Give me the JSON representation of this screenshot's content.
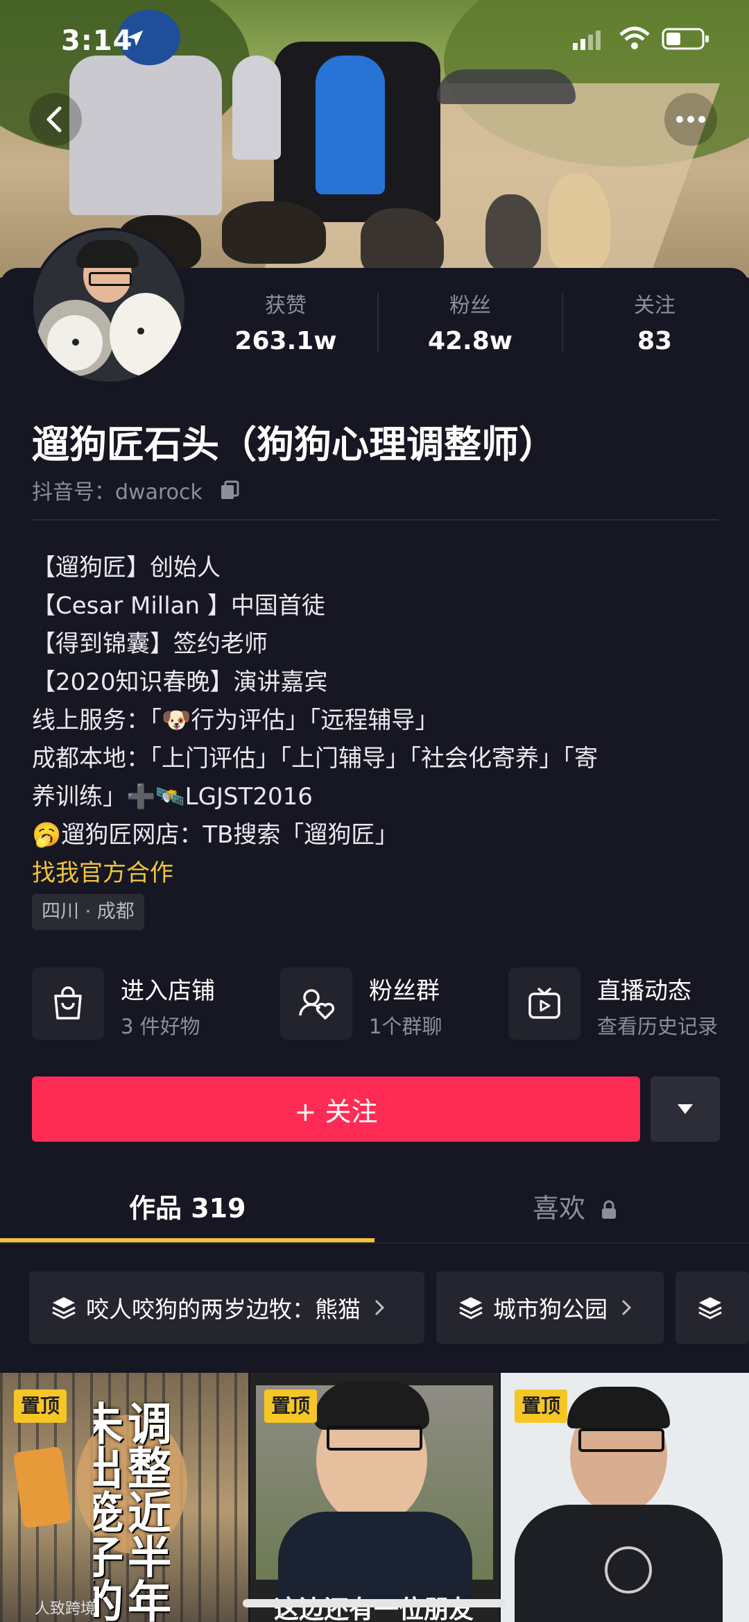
{
  "status_bar": {
    "time": "3:14"
  },
  "profile": {
    "stats": [
      {
        "label": "获赞",
        "value": "263.1w"
      },
      {
        "label": "粉丝",
        "value": "42.8w"
      },
      {
        "label": "关注",
        "value": "83"
      }
    ],
    "name": "遛狗匠石头（狗狗心理调整师）",
    "douyin_id": "抖音号：dwarock",
    "bio_lines": [
      "【遛狗匠】创始人",
      "【Cesar Millan 】中国首徒",
      "【得到锦囊】签约老师",
      "【2020知识春晚】演讲嘉宾",
      "线上服务：「🐶行为评估」「远程辅导」",
      "成都本地：「上门评估」「上门辅导」「社会化寄养」「寄",
      "养训练」➕🛰️LGJST2016",
      "🥱遛狗匠网店：TB搜索「遛狗匠」"
    ],
    "cooperation_link": "找我官方合作",
    "location": "四川 · 成都"
  },
  "features": [
    {
      "title": "进入店铺",
      "subtitle": "3 件好物",
      "icon": "shopping-bag-icon"
    },
    {
      "title": "粉丝群",
      "subtitle": "1个群聊",
      "icon": "fan-group-icon"
    },
    {
      "title": "直播动态",
      "subtitle": "查看历史记录",
      "icon": "live-tv-icon"
    }
  ],
  "actions": {
    "follow_label": "+ 关注",
    "more_icon": "dropdown-triangle-icon"
  },
  "tabs": [
    {
      "label": "作品 319",
      "active": true
    },
    {
      "label": "喜欢",
      "locked": true
    }
  ],
  "collections": [
    {
      "label": "咬人咬狗的两岁边牧：熊猫"
    },
    {
      "label": "城市狗公园"
    }
  ],
  "videos": [
    {
      "badge": "置顶",
      "overlay_text": "调整近半年 未出笼子的狗",
      "watermark": "人致跨境"
    },
    {
      "badge": "置顶",
      "caption": "这边还有一位朋友"
    },
    {
      "badge": "置顶"
    }
  ],
  "colors": {
    "accent_red": "#fe2c55",
    "accent_yellow": "#f3c33b",
    "background": "#161722"
  }
}
